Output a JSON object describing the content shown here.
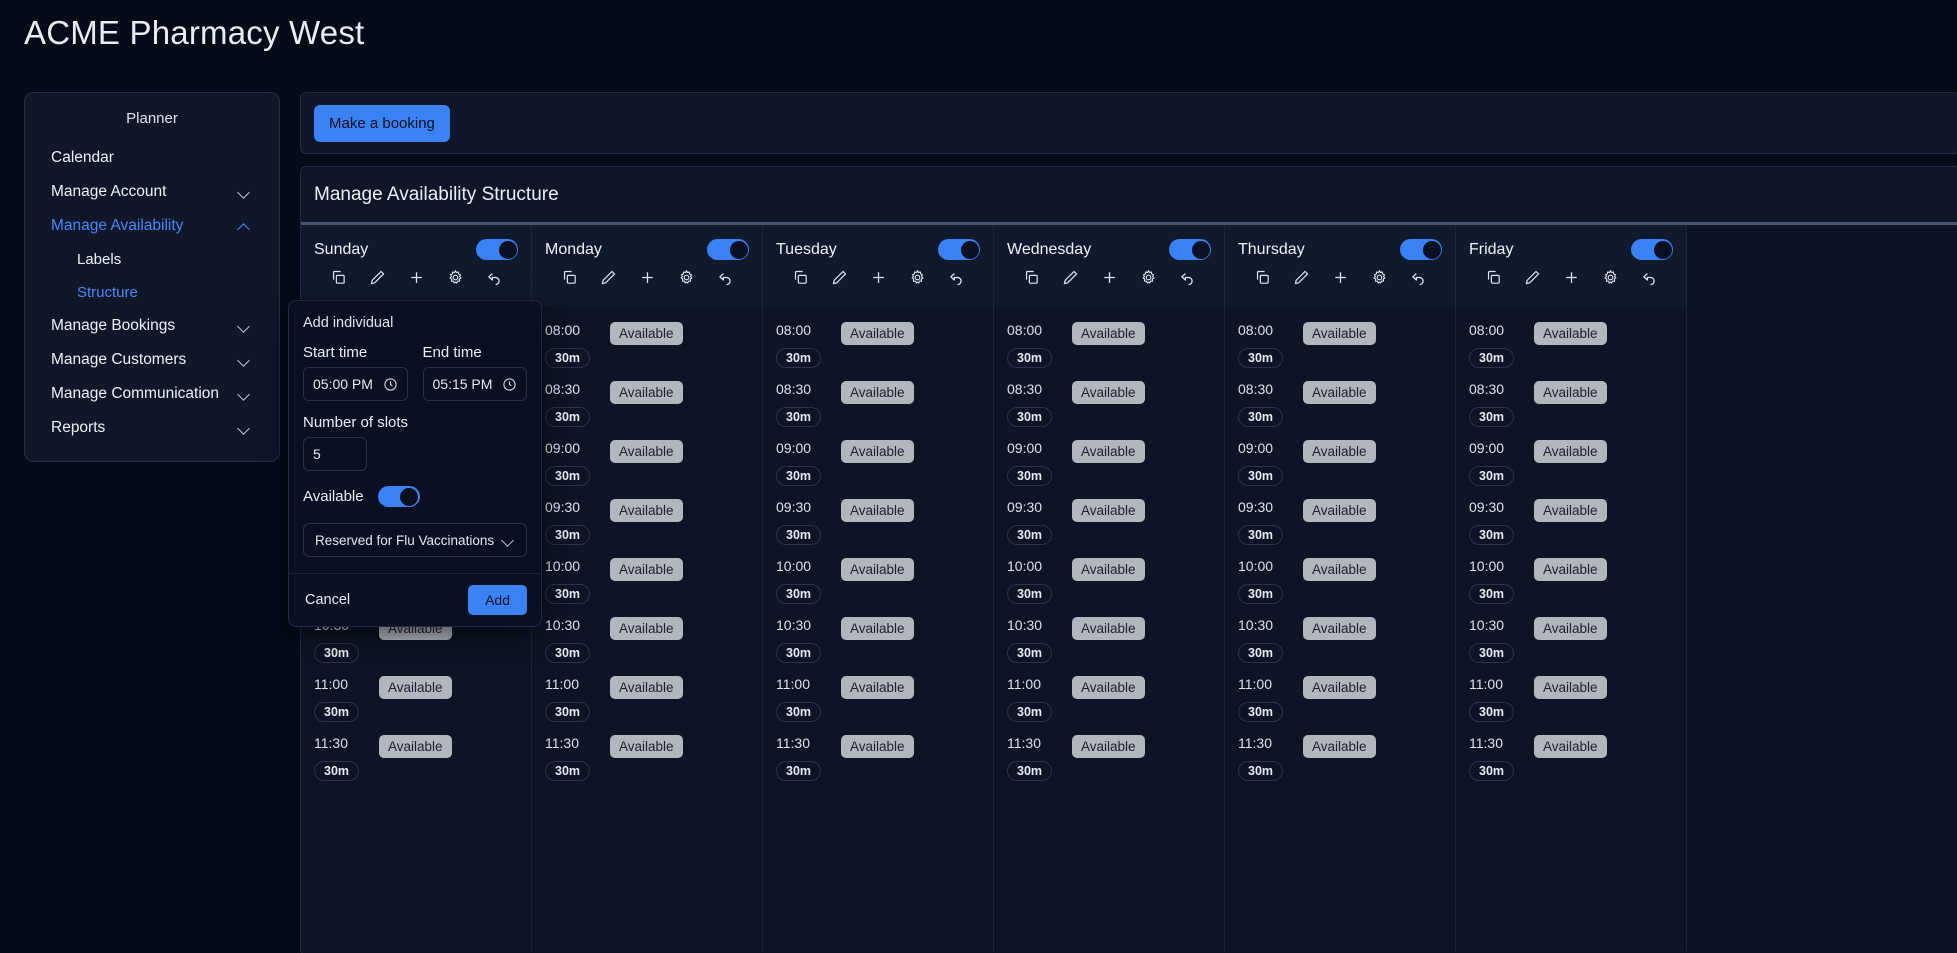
{
  "page": {
    "title": "ACME Pharmacy West"
  },
  "sidebar": {
    "heading": "Planner",
    "items": [
      {
        "label": "Calendar",
        "chevron": "none",
        "sub": false,
        "active": false
      },
      {
        "label": "Manage Account",
        "chevron": "down",
        "sub": false,
        "active": false
      },
      {
        "label": "Manage Availability",
        "chevron": "up",
        "sub": false,
        "active": true
      },
      {
        "label": "Labels",
        "chevron": "none",
        "sub": true,
        "active": false
      },
      {
        "label": "Structure",
        "chevron": "none",
        "sub": true,
        "active": true
      },
      {
        "label": "Manage Bookings",
        "chevron": "down",
        "sub": false,
        "active": false
      },
      {
        "label": "Manage Customers",
        "chevron": "down",
        "sub": false,
        "active": false
      },
      {
        "label": "Manage Communication",
        "chevron": "down",
        "sub": false,
        "active": false
      },
      {
        "label": "Reports",
        "chevron": "down",
        "sub": false,
        "active": false
      }
    ]
  },
  "toolbar": {
    "make_booking_label": "Make a booking"
  },
  "panel": {
    "title": "Manage Availability Structure"
  },
  "day_icons": [
    "copy-icon",
    "pencil-icon",
    "plus-icon",
    "gear-icon",
    "undo-icon"
  ],
  "slot_labels": {
    "available": "Available",
    "duration": "30m"
  },
  "days": [
    {
      "name": "Sunday",
      "enabled": true
    },
    {
      "name": "Monday",
      "enabled": true
    },
    {
      "name": "Tuesday",
      "enabled": true
    },
    {
      "name": "Wednesday",
      "enabled": true
    },
    {
      "name": "Thursday",
      "enabled": true
    },
    {
      "name": "Friday",
      "enabled": true
    }
  ],
  "times": [
    "08:00",
    "08:30",
    "09:00",
    "09:30",
    "10:00",
    "10:30",
    "11:00",
    "11:30"
  ],
  "popup": {
    "title": "Add individual",
    "start_label": "Start time",
    "start_value": "05:00 PM",
    "end_label": "End time",
    "end_value": "05:15 PM",
    "slots_label": "Number of slots",
    "slots_value": "5",
    "available_label": "Available",
    "available_on": true,
    "label_select_value": "Reserved for Flu Vaccinations",
    "cancel_label": "Cancel",
    "add_label": "Add"
  },
  "colors": {
    "accent": "#3b82f6",
    "badge": "#b2b6bd",
    "panel": "#0c1324",
    "surface": "#101729"
  }
}
